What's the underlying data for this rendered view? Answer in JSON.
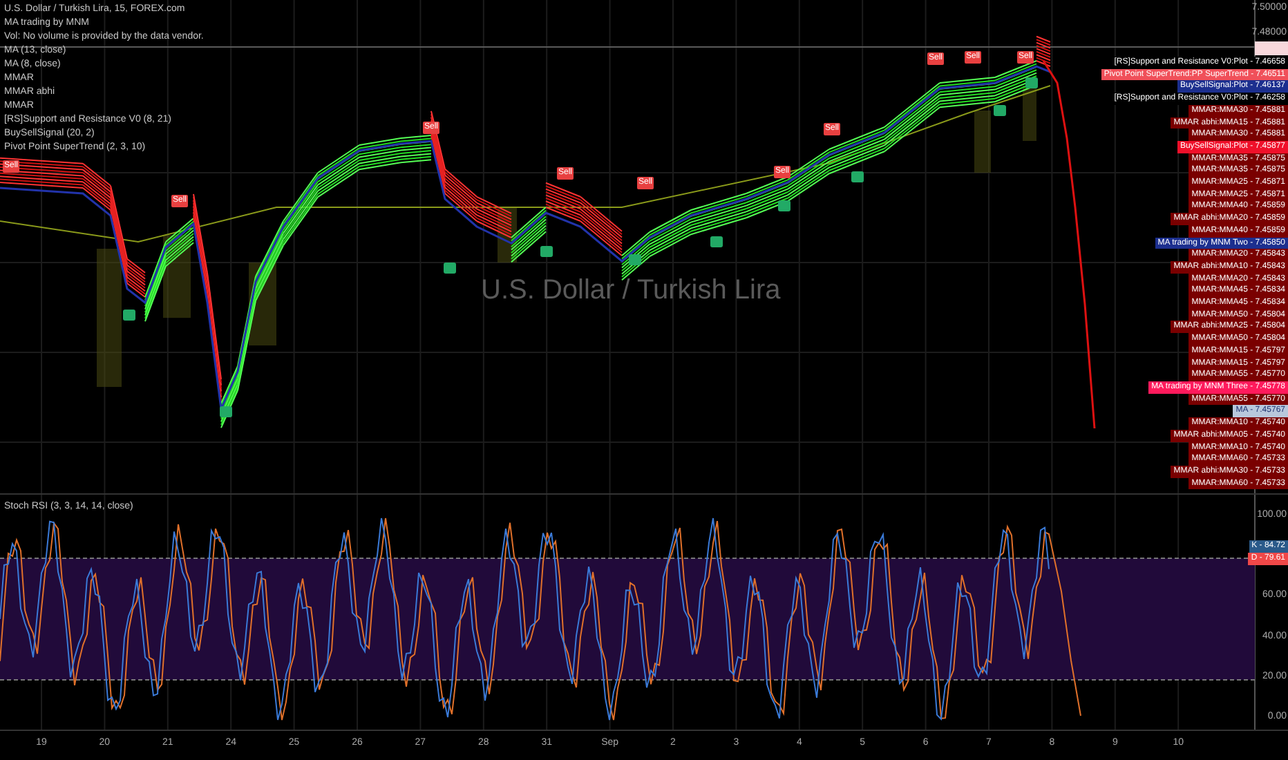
{
  "legend": [
    "U.S. Dollar / Turkish Lira, 15, FOREX.com",
    "MA trading by MNM",
    "Vol: No volume is provided by the data vendor.",
    "MA (13, close)",
    "MA (8, close)",
    "MMAR",
    "MMAR abhi",
    "MMAR",
    "[RS]Support and Resistance V0 (8, 21)",
    "BuySellSignal (20, 2)",
    "Pivot Point SuperTrend (2, 3, 10)"
  ],
  "symbol_watermark": "U.S. Dollar / Turkish Lira",
  "signal_markers": [
    {
      "text": "Sell"
    },
    {
      "text": "Sell"
    },
    {
      "text": "Sell"
    },
    {
      "text": "Sell"
    },
    {
      "text": "Sell"
    },
    {
      "text": "Sell"
    },
    {
      "text": "Sell"
    },
    {
      "text": "Sell"
    },
    {
      "text": "Sell"
    },
    {
      "text": "Sell"
    }
  ],
  "price_axis": [
    "7.50000",
    "7.48000"
  ],
  "price_labels": [
    {
      "text": "[RS]Support and Resistance V0:Plot - 7.46658",
      "color": "#000000"
    },
    {
      "text": "Pivot Point SuperTrend:PP SuperTrend - 7.46511",
      "color": "#f0505a"
    },
    {
      "text": "BuySellSignal:Plot - 7.46137",
      "color": "#1c2f8f"
    },
    {
      "text": "[RS]Support and Resistance V0:Plot - 7.46258",
      "color": "#000000"
    },
    {
      "text": "MMAR:MMA30 - 7.45881",
      "color": "#7a0000"
    },
    {
      "text": "MMAR abhi:MMA15 - 7.45881",
      "color": "#7a0000"
    },
    {
      "text": "MMAR:MMA30 - 7.45881",
      "color": "#7a0000"
    },
    {
      "text": "BuySellSignal:Plot - 7.45877",
      "color": "#f0102a"
    },
    {
      "text": "MMAR:MMA35 - 7.45875",
      "color": "#7a0000"
    },
    {
      "text": "MMAR:MMA35 - 7.45875",
      "color": "#7a0000"
    },
    {
      "text": "MMAR:MMA25 - 7.45871",
      "color": "#7a0000"
    },
    {
      "text": "MMAR:MMA25 - 7.45871",
      "color": "#7a0000"
    },
    {
      "text": "MMAR:MMA40 - 7.45859",
      "color": "#7a0000"
    },
    {
      "text": "MMAR abhi:MMA20 - 7.45859",
      "color": "#7a0000"
    },
    {
      "text": "MMAR:MMA40 - 7.45859",
      "color": "#7a0000"
    },
    {
      "text": "MA trading by MNM Two - 7.45850",
      "color": "#1c2f8f"
    },
    {
      "text": "MMAR:MMA20 - 7.45843",
      "color": "#7a0000"
    },
    {
      "text": "MMAR abhi:MMA10 - 7.45843",
      "color": "#7a0000"
    },
    {
      "text": "MMAR:MMA20 - 7.45843",
      "color": "#7a0000"
    },
    {
      "text": "MMAR:MMA45 - 7.45834",
      "color": "#7a0000"
    },
    {
      "text": "MMAR:MMA45 - 7.45834",
      "color": "#7a0000"
    },
    {
      "text": "MMAR:MMA50 - 7.45804",
      "color": "#7a0000"
    },
    {
      "text": "MMAR abhi:MMA25 - 7.45804",
      "color": "#7a0000"
    },
    {
      "text": "MMAR:MMA50 - 7.45804",
      "color": "#7a0000"
    },
    {
      "text": "MMAR:MMA15 - 7.45797",
      "color": "#7a0000"
    },
    {
      "text": "MMAR:MMA15 - 7.45797",
      "color": "#7a0000"
    },
    {
      "text": "MMAR:MMA55 - 7.45770",
      "color": "#7a0000"
    },
    {
      "text": "MA trading by MNM Three - 7.45778",
      "color": "#ff1a5c"
    },
    {
      "text": "MMAR:MMA55 - 7.45770",
      "color": "#7a0000"
    },
    {
      "text": "MA - 7.45767",
      "color": "#b8c8dc"
    },
    {
      "text": "MMAR:MMA10 - 7.45740",
      "color": "#7a0000"
    },
    {
      "text": "MMAR abhi:MMA05 - 7.45740",
      "color": "#7a0000"
    },
    {
      "text": "MMAR:MMA10 - 7.45740",
      "color": "#7a0000"
    },
    {
      "text": "MMAR:MMA60 - 7.45733",
      "color": "#7a0000"
    },
    {
      "text": "MMAR abhi:MMA30 - 7.45733",
      "color": "#7a0000"
    },
    {
      "text": "MMAR:MMA60 - 7.45733",
      "color": "#7a0000"
    }
  ],
  "stoch_rsi": {
    "title": "Stoch RSI (3, 3, 14, 14, close)",
    "axis": [
      "100.00",
      "60.00",
      "40.00",
      "20.00",
      "0.00"
    ],
    "labels": [
      {
        "text": "K - 84.72",
        "color": "#2a5a8a"
      },
      {
        "text": "D - 79.61",
        "color": "#f04848"
      }
    ]
  },
  "time_axis": [
    "19",
    "20",
    "21",
    "24",
    "25",
    "26",
    "27",
    "28",
    "31",
    "Sep",
    "2",
    "3",
    "4",
    "5",
    "6",
    "7",
    "8",
    "9",
    "10"
  ]
}
